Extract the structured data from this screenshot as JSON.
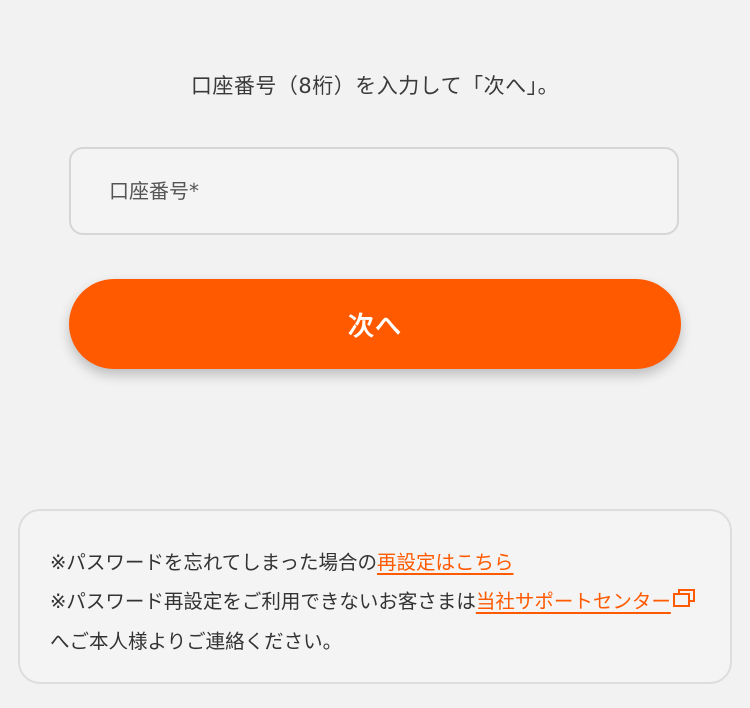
{
  "instruction": "口座番号（8桁）を入力して「次へ」。",
  "account_input": {
    "placeholder": "口座番号*",
    "value": ""
  },
  "next_button": {
    "label": "次へ"
  },
  "notice": {
    "line1_prefix": "※パスワードを忘れてしまった場合の",
    "line1_link": "再設定はこちら",
    "line2_prefix": "※パスワード再設定をご利用できないお客さまは",
    "line2_link": "当社サポートセンター",
    "line2_suffix": "へご本人様よりご連絡ください。",
    "external_icon": "external-window-icon"
  },
  "colors": {
    "accent": "#ff5a00",
    "background": "#f2f2f2",
    "text": "#333333",
    "border": "#d6d6d6"
  }
}
